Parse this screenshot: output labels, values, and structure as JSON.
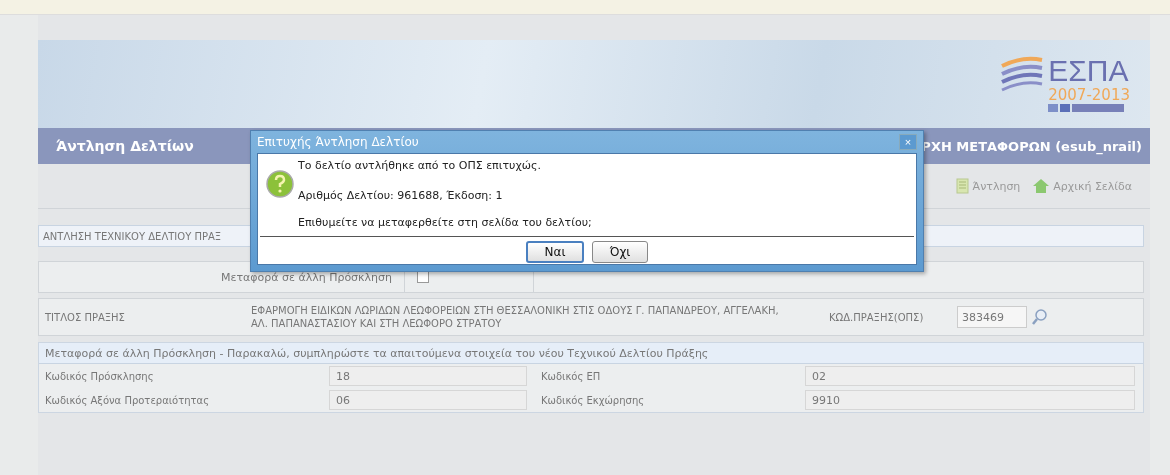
{
  "logo": {
    "title": "ΕΣΠΑ",
    "years": "2007-2013"
  },
  "header": {
    "title": "Άντληση Δελτίων",
    "user": "ΡΧΗ ΜΕΤΑΦΟΡΩΝ (esub_nrail)"
  },
  "toolbar": [
    {
      "kind": "fetch",
      "label": "Άντληση"
    },
    {
      "kind": "home",
      "label": "Αρχική Σελίδα"
    }
  ],
  "section_title": "ΑΝΤΛΗΣΗ ΤΕΧΝΙΚΟΥ ΔΕΛΤΙΟΥ ΠΡΑΞ",
  "transfer": {
    "label": "Μεταφορά σε άλλη Πρόσκληση",
    "checked": false
  },
  "project": {
    "label": "ΤΙΤΛΟΣ ΠΡΑΞΗΣ",
    "title": "ΕΦΑΡΜΟΓΗ ΕΙΔΙΚΩΝ ΛΩΡΙΔΩΝ ΛΕΩΦΟΡΕΙΩΝ ΣΤΗ ΘΕΣΣΑΛΟΝΙΚΗ ΣΤΙΣ ΟΔΟΥΣ Γ. ΠΑΠΑΝΔΡΕΟΥ, ΑΓΓΕΛΑΚΗ, ΑΛ. ΠΑΠΑΝΑΣΤΑΣΙΟΥ ΚΑΙ ΣΤΗ ΛΕΩΦΟΡΟ ΣΤΡΑΤΟΥ",
    "code_label": "ΚΩΔ.ΠΡΑΞΗΣ(ΟΠΣ)",
    "code": "383469"
  },
  "details": {
    "title": "Μεταφορά σε άλλη Πρόσκληση - Παρακαλώ, συμπληρώστε τα απαιτούμενα στοιχεία του νέου Τεχνικού Δελτίου Πράξης",
    "rows": [
      [
        {
          "label": "Κωδικός Πρόσκλησης",
          "value": "18"
        },
        {
          "label": "Κωδικός ΕΠ",
          "value": "02"
        }
      ],
      [
        {
          "label": "Κωδικός Αξόνα Προτεραιότητας",
          "value": "06"
        },
        {
          "label": "Κωδικός Εκχώρησης",
          "value": "9910"
        }
      ]
    ]
  },
  "dialog": {
    "title": "Επιτυχής Άντληση Δελτίου",
    "close": "×",
    "lines": [
      "Το δελτίο αντλήθηκε από το ΟΠΣ επιτυχώς.",
      "Αριθμός Δελτίου: 961688, Έκδοση: 1",
      "Επιθυμείτε να μεταφερθείτε στη σελίδα του δελτίου;"
    ],
    "buttons": [
      {
        "label": "Ναι",
        "selected": true
      },
      {
        "label": "Όχι",
        "selected": false
      }
    ]
  }
}
